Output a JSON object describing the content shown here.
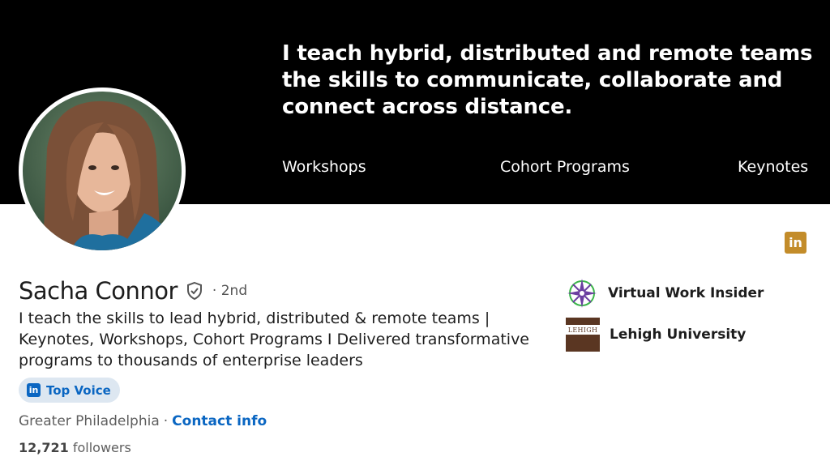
{
  "banner": {
    "headline_lines": [
      "I teach hybrid, distributed and remote teams",
      "the skills to communicate, collaborate and",
      "connect  across distance."
    ],
    "links": [
      "Workshops",
      "Cohort Programs",
      "Keynotes"
    ],
    "background": "#000000"
  },
  "profile": {
    "name": "Sacha Connor",
    "degree": "· 2nd",
    "bio_lines": [
      "I teach the skills to lead hybrid, distributed & remote teams |",
      "Keynotes, Workshops, Cohort Programs I Delivered transformative",
      "programs to thousands of enterprise leaders"
    ],
    "badge_label": "Top Voice",
    "badge_icon_text": "in",
    "location": "Greater Philadelphia",
    "separator": "·",
    "contact_label": "Contact info",
    "followers_count": "12,721",
    "followers_label": "followers"
  },
  "linkedin_badge_text": "in",
  "organizations": [
    {
      "name": "Virtual Work Insider",
      "icon": "compass-logo"
    },
    {
      "name": "Lehigh University",
      "icon": "lehigh-logo",
      "logo_text": "LEHIGH"
    }
  ],
  "colors": {
    "link_blue": "#0a66c2",
    "badge_bg": "#dde7f1",
    "linkedin_gold": "#c38c2a",
    "lehigh_brown": "#5a3622"
  }
}
